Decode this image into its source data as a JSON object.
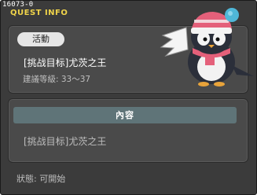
{
  "window": {
    "quest_id": "16073-0",
    "title": "QUEST INFO"
  },
  "summary": {
    "badge": "活動",
    "quest_name": "[挑战目标]尤茨之王",
    "level_requirement": "建議等級: 33～37"
  },
  "content": {
    "header": "內容",
    "text": "[挑战目标]尤茨之王"
  },
  "footer": {
    "status": "狀態: 可開始"
  },
  "colors": {
    "title_accent": "#f0d44a",
    "section_bar": "#5f7478",
    "panel": "#4a4a4a",
    "window_bg": "#3b3b3b"
  },
  "icons": [
    "penguin-mascot-icon"
  ]
}
